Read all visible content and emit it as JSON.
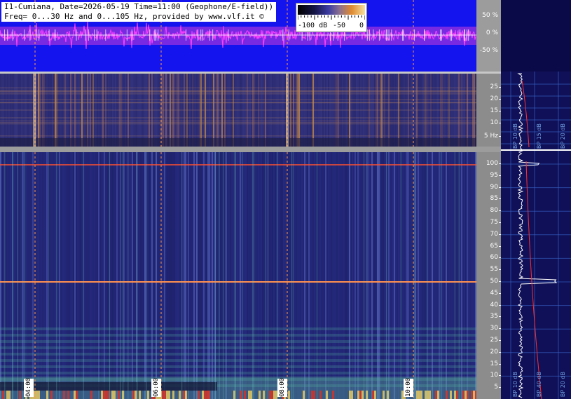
{
  "header": {
    "line1": "I1-Cumiana, Date=2026-05-19 Time=11:00 (Geophone/E-field))",
    "line2": "Freq= 0...30 Hz and 0...105 Hz, provided by www.vlf.it ©"
  },
  "colorbar": {
    "labels": [
      "-100 dB",
      "-50",
      "0"
    ]
  },
  "waveform_axis": [
    "50 %",
    "0 %",
    "-50 %"
  ],
  "upper_freq_labels": [
    "25",
    "20",
    "15",
    "10",
    "5 Hz"
  ],
  "lower_freq_labels": [
    "100",
    "95",
    "90",
    "85",
    "80",
    "75",
    "70",
    "65",
    "60",
    "55",
    "50",
    "45",
    "40",
    "35",
    "30",
    "25",
    "20",
    "15",
    "10",
    "5"
  ],
  "time_markers": [
    "04:00",
    "06:00",
    "08:00",
    "10:00"
  ],
  "profile_labels_upper": [
    "BP 10 dB",
    "BP 15 dB",
    "BP 20 dB"
  ],
  "profile_labels_lower": [
    "BP 10 dB",
    "BP 40 dB",
    "BP 20 dB"
  ],
  "colors": {
    "waveform_bg": "#1414ee",
    "waveform_trace": "#ff40ff",
    "spectro_upper_bg": "#24246a",
    "spectro_lower_bg": "#2a2e88",
    "mains_line": "#ff5030",
    "axis_bg": "#8c8c8c",
    "profile_bg": "#0a0a48"
  }
}
